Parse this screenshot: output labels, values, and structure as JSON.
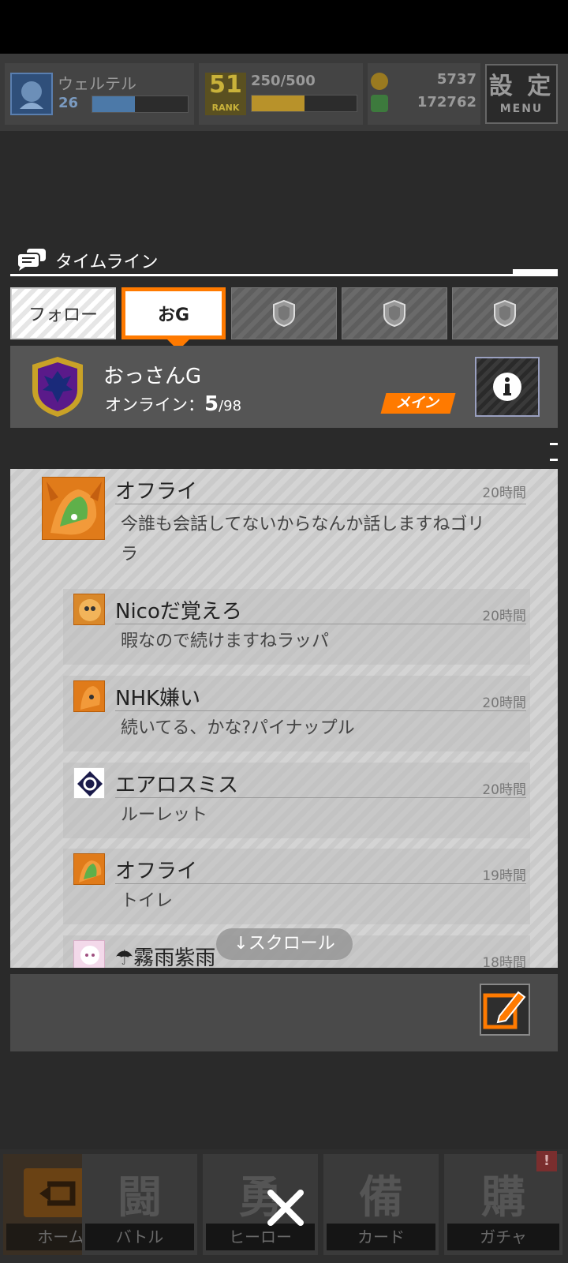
{
  "status": {
    "user_name": "ウェルテル",
    "user_level": "26",
    "exp_progress": 0.45,
    "rank": "51",
    "rank_label": "RANK",
    "stamina": "250/500",
    "stamina_progress": 0.5,
    "coins": "5737",
    "gems": "172762",
    "menu_kanji": "設 定",
    "menu_label": "MENU"
  },
  "timeline": {
    "title": "タイムライン",
    "tabs": [
      {
        "label": "フォロー"
      },
      {
        "label": "おG",
        "active": true
      }
    ]
  },
  "guild": {
    "name": "おっさんG",
    "online_label": "オンライン：",
    "online_count": "5",
    "online_total": "/98",
    "main_badge": "メイン"
  },
  "posts": [
    {
      "name": "オフライ",
      "time": "20時間",
      "message_line1": "今誰も会話してないからなんか話しますねゴリ",
      "message_line2": "ラ"
    },
    {
      "name": "Nicoだ覚えろ",
      "time": "20時間",
      "message": "暇なので続けますねラッパ"
    },
    {
      "name": "NHK嫌い",
      "time": "20時間",
      "message": "続いてる、かな?パイナップル"
    },
    {
      "name": "エアロスミス",
      "time": "20時間",
      "message": "ルーレット"
    },
    {
      "name": "オフライ",
      "time": "19時間",
      "message": "トイレ"
    },
    {
      "name": "☂霧雨紫雨",
      "time": "18時間"
    }
  ],
  "scroll_hint": "↓スクロール",
  "nav": {
    "items": [
      {
        "label": "ホーム",
        "big": ""
      },
      {
        "label": "バトル",
        "big": "闘"
      },
      {
        "label": "ヒーロー",
        "big": "勇"
      },
      {
        "label": "カード",
        "big": "備"
      },
      {
        "label": "ガチャ",
        "big": "購"
      }
    ],
    "badge": "!"
  },
  "colors": {
    "accent": "#ff7a00",
    "background": "#2a2a2a",
    "panel": "#555555"
  }
}
